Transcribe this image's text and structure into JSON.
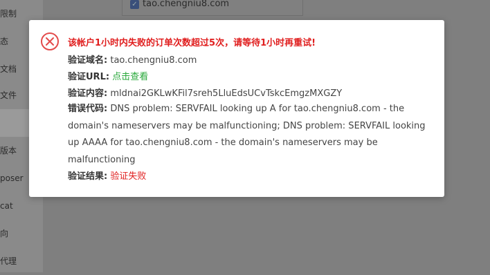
{
  "sidebar": {
    "items": [
      {
        "label": "限制"
      },
      {
        "label": "态"
      },
      {
        "label": "文档"
      },
      {
        "label": "文件"
      },
      {
        "label": ""
      },
      {
        "label": "版本"
      },
      {
        "label": "poser"
      },
      {
        "label": "cat"
      },
      {
        "label": "向"
      },
      {
        "label": "代理"
      }
    ]
  },
  "background": {
    "domain_checkbox_label": "tao.chengniu8.com"
  },
  "dialog": {
    "icon": "close-circle-icon",
    "title": "该帐户1小时内失败的订单次数超过5次，请等待1小时再重试!",
    "domain_label": "验证域名:",
    "domain_value": "tao.chengniu8.com",
    "url_label": "验证URL:",
    "url_link": "点击查看",
    "content_label": "验证内容:",
    "content_value": "mldnai2GKLwKFil7sreh5LluEdsUCvTskcEmgzMXGZY",
    "error_label": "错误代码:",
    "error_value": "DNS problem: SERVFAIL looking up A for tao.chengniu8.com - the domain's nameservers may be malfunctioning; DNS problem: SERVFAIL looking up AAAA for tao.chengniu8.com - the domain's nameservers may be malfunctioning",
    "result_label": "验证结果:",
    "result_value": "验证失败"
  },
  "colors": {
    "error_red": "#e01e1e",
    "link_green": "#27a83a",
    "overlay": "#7f7f7f"
  }
}
